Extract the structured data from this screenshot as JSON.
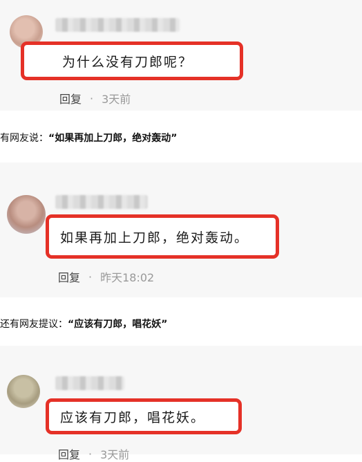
{
  "comments": [
    {
      "text": "为什么没有刀郎呢？",
      "reply_label": "回复",
      "separator": "·",
      "time": "3天前"
    },
    {
      "text": "如果再加上刀郎，绝对轰动。",
      "reply_label": "回复",
      "separator": "·",
      "time": "昨天18:02"
    },
    {
      "text": "应该有刀郎，唱花妖。",
      "reply_label": "回复",
      "separator": "·",
      "time": "3天前"
    }
  ],
  "captions": [
    {
      "prefix": "有网友说：",
      "quote": "“如果再加上刀郎，绝对轰动”"
    },
    {
      "prefix": "还有网友提议：",
      "quote": "“应该有刀郎，唱花妖”"
    }
  ],
  "colors": {
    "highlight": "#e53127",
    "panel": "#f7f7f7",
    "meta": "#999999"
  }
}
